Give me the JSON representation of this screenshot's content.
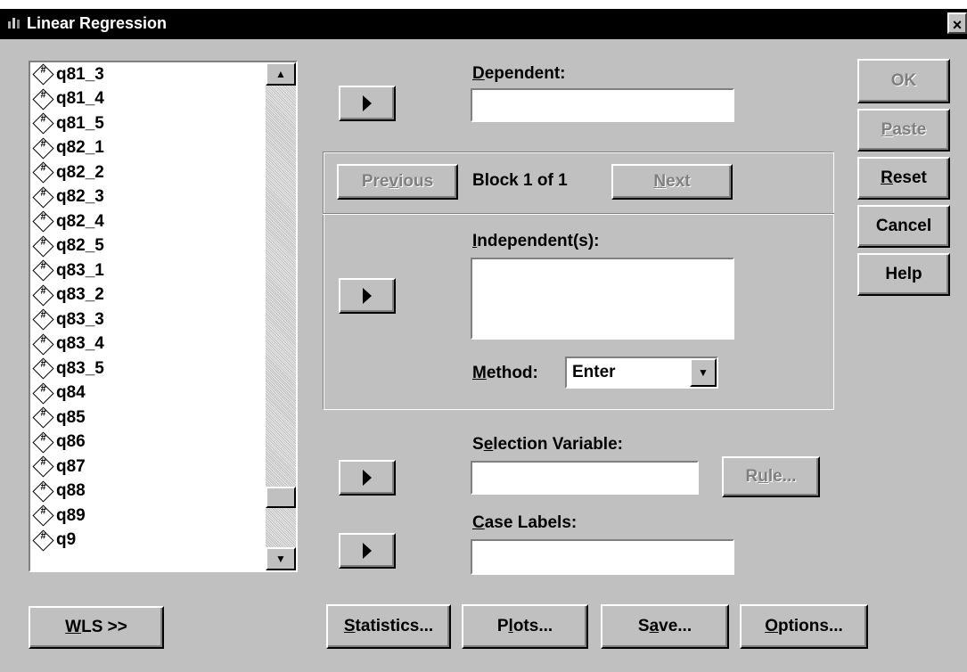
{
  "window": {
    "title": "Linear Regression",
    "close_glyph": "×"
  },
  "variables": [
    "q81_3",
    "q81_4",
    "q81_5",
    "q82_1",
    "q82_2",
    "q82_3",
    "q82_4",
    "q82_5",
    "q83_1",
    "q83_2",
    "q83_3",
    "q83_4",
    "q83_5",
    "q84",
    "q85",
    "q86",
    "q87",
    "q88",
    "q89",
    "q9"
  ],
  "variable_icon": "#",
  "dependent": {
    "label_first": "D",
    "label_rest": "ependent:",
    "value": ""
  },
  "block": {
    "previous_pre": "Pre",
    "previous_u": "v",
    "previous_post": "ious",
    "label": "Block 1 of 1",
    "next_u": "N",
    "next_post": "ext"
  },
  "independents": {
    "label_first": "I",
    "label_rest": "ndependent(s):",
    "value": ""
  },
  "method": {
    "label_first": "M",
    "label_rest": "ethod:",
    "value": "Enter"
  },
  "selection": {
    "label_pre": "S",
    "label_u": "e",
    "label_post": "lection Variable:",
    "value": "",
    "rule_pre": "R",
    "rule_u": "u",
    "rule_post": "le..."
  },
  "case_labels": {
    "label_first": "C",
    "label_rest": "ase Labels:",
    "value": ""
  },
  "side_buttons": {
    "ok": "OK",
    "paste_first": "P",
    "paste_rest": "aste",
    "reset_first": "R",
    "reset_rest": "eset",
    "cancel": "Cancel",
    "help": "Help"
  },
  "bottom_buttons": {
    "wls_first": "W",
    "wls_rest": "LS >>",
    "statistics_first": "S",
    "statistics_rest": "tatistics...",
    "plots_pre": "P",
    "plots_u": "l",
    "plots_post": "ots...",
    "save_pre": "S",
    "save_u": "a",
    "save_post": "ve...",
    "options_first": "O",
    "options_rest": "ptions..."
  }
}
